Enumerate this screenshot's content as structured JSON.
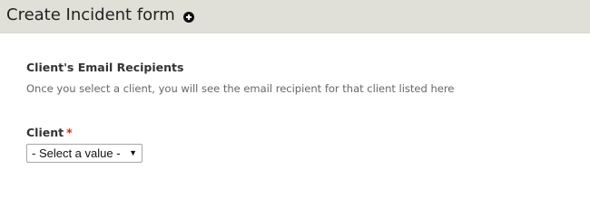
{
  "header": {
    "title": "Create Incident form",
    "add_icon": "add-circle-icon"
  },
  "recipients": {
    "title": "Client's Email Recipients",
    "description": "Once you select a client, you will see the email recipient for that client listed here"
  },
  "client": {
    "label": "Client",
    "required_mark": "*",
    "selected_value": "- Select a value -",
    "arrow": "▼"
  },
  "colors": {
    "header_bg": "#e1e0d8",
    "required": "#e22222"
  }
}
